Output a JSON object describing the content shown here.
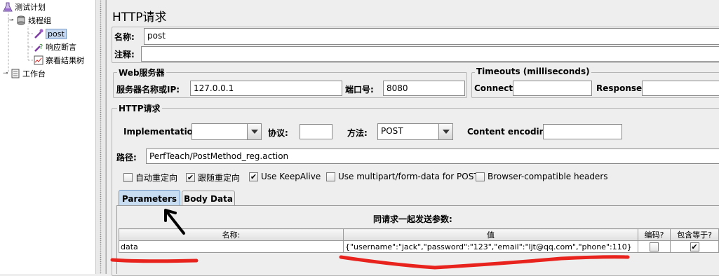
{
  "tree": {
    "items": [
      {
        "label": "测试计划"
      },
      {
        "label": "线程组"
      },
      {
        "label": "post"
      },
      {
        "label": "响应断言"
      },
      {
        "label": "察看结果树"
      },
      {
        "label": "工作台"
      }
    ]
  },
  "panel": {
    "title": "HTTP请求",
    "name_label": "名称:",
    "name_value": "post",
    "comment_label": "注释:",
    "comment_value": ""
  },
  "web_server": {
    "title": "Web服务器",
    "server_label": "服务器名称或IP:",
    "server_value": "127.0.0.1",
    "port_label": "端口号:",
    "port_value": "8080"
  },
  "timeouts": {
    "title": "Timeouts (milliseconds)",
    "connect_label": "Connect:",
    "connect_value": "",
    "response_label": "Response:",
    "response_value": ""
  },
  "http_request": {
    "title": "HTTP请求",
    "implementation_label": "Implementation:",
    "implementation_value": "",
    "protocol_label": "协议:",
    "protocol_value": "",
    "method_label": "方法:",
    "method_value": "POST",
    "encoding_label": "Content encoding:",
    "encoding_value": "",
    "path_label": "路径:",
    "path_value": "PerfTeach/PostMethod_reg.action"
  },
  "options": [
    {
      "label": "自动重定向",
      "checked": false
    },
    {
      "label": "跟随重定向",
      "checked": true
    },
    {
      "label": "Use KeepAlive",
      "checked": true
    },
    {
      "label": "Use multipart/form-data for POST",
      "checked": false
    },
    {
      "label": "Browser-compatible headers",
      "checked": false
    }
  ],
  "tabs": {
    "parameters": "Parameters",
    "body_data": "Body Data",
    "active": "Parameters"
  },
  "params": {
    "caption": "同请求一起发送参数:",
    "columns": [
      "名称:",
      "值",
      "编码?",
      "包含等于?"
    ],
    "rows": [
      {
        "name": "data",
        "value": "{\"username\":\"jack\",\"password\":\"123\",\"email\":\"ljt@qq.com\",\"phone\":110}",
        "encode": false,
        "include_equals": true
      }
    ]
  },
  "annotation_colors": {
    "underline": "#e8231e",
    "arrow": "#000000"
  }
}
